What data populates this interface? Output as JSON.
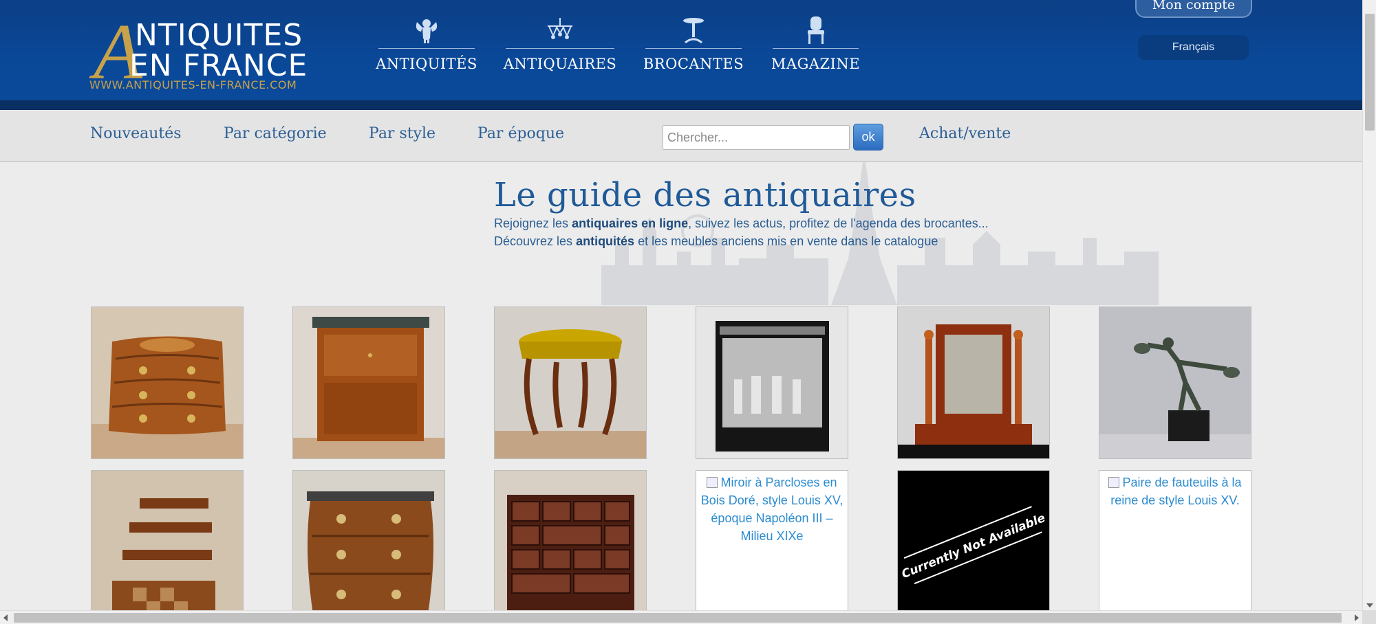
{
  "header": {
    "logo": {
      "line1": "NTIQUITES",
      "line2": "EN FRANCE",
      "big_letter": "A",
      "url": "WWW.ANTIQUITES-EN-FRANCE.COM"
    },
    "main_nav": [
      {
        "label": "ANTIQUITÉS",
        "icon": "cherub-icon"
      },
      {
        "label": "ANTIQUAIRES",
        "icon": "chandelier-icon"
      },
      {
        "label": "BROCANTES",
        "icon": "pedestal-table-icon"
      },
      {
        "label": "MAGAZINE",
        "icon": "armchair-icon"
      }
    ],
    "account_label": "Mon compte",
    "language": "Français"
  },
  "sub_nav": {
    "links": [
      "Nouveautés",
      "Par catégorie",
      "Par style",
      "Par époque"
    ],
    "search_placeholder": "Chercher...",
    "search_button": "ok",
    "trade_link": "Achat/vente"
  },
  "intro": {
    "title": "Le guide des antiquaires",
    "line1_before": "Rejoignez les ",
    "line1_bold": "antiquaires en ligne",
    "line1_after": ", suivez les actus, profitez de l'agenda des brocantes...",
    "line2_before": "Découvrez les ",
    "line2_bold": "antiquités",
    "line2_after": " et les meubles anciens mis en vente dans le catalogue"
  },
  "products": [
    {
      "kind": "commode-bowed"
    },
    {
      "kind": "secretaire"
    },
    {
      "kind": "stool"
    },
    {
      "kind": "liquor-cabinet"
    },
    {
      "kind": "dressing-mirror"
    },
    {
      "kind": "bronze-dancer"
    },
    {
      "kind": "nesting-tables"
    },
    {
      "kind": "commode-tombeau"
    },
    {
      "kind": "cabinet-drawers"
    },
    {
      "kind": "broken",
      "alt": "Miroir à Parcloses en Bois Doré, style Louis XV, époque Napoléon III – Milieu XIXe"
    },
    {
      "kind": "not-available",
      "alt": "Currently Not Available"
    },
    {
      "kind": "broken",
      "alt": "Paire de fauteuils à la reine de style Louis XV."
    }
  ],
  "colors": {
    "header_blue": "#0b4a9b",
    "gold": "#c8a24a",
    "link_blue": "#2d5f95",
    "title_blue": "#1f5a98"
  }
}
